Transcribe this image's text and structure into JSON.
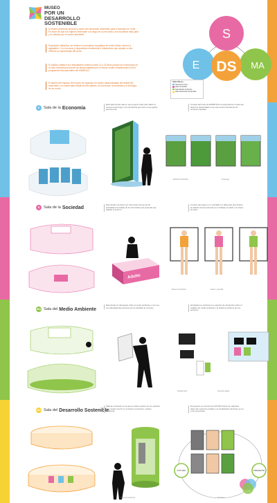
{
  "colors": {
    "blue": "#6fc1e8",
    "orange": "#f3a23a",
    "pink": "#e86aa4",
    "green": "#8fc54a",
    "yellow": "#f6d234",
    "forest": "#3d8a3a",
    "gray": "#b7b7b7"
  },
  "header": {
    "museo": "MUSEO",
    "por_un": "POR UN",
    "desarrollo": "DESARROLLO",
    "sostenible": "SOSTENIBLE",
    "intro_1": "El Museo pretende acercar la visión del desarrollo sostenible para el llamado de Chile. En favor de que los viajeros entiendan a lo largo de su recorrido, una sociedad más justa y el cuidado por el medio ambiente.",
    "intro_2": "Exposición didáctica, se centra en conceptos complejos de modo eficaz, ameno y agradable. Con recursos y dispositivos multimedia e interactivos que ayudan a una reflexión al aprendizaje del tema.",
    "intro_3": "El público objetivo son estudiantes chilenos entre 11 y 18 años porque se encuentran en el ciclo educacional donde los temas tratados por el museo están considerados en los programas educacionales del MINEDUC.",
    "intro_4": "El diseño del espacio del museo se organiza en cuatro salas basadas del desarrollo sostenible. La cuarta sala refleja los tres pilares: la economía, la sociedad y la ecología de un modo.",
    "venn": {
      "s": "S",
      "e": "E",
      "ma": "MA",
      "ds": "DS"
    },
    "legend": [
      {
        "label": "Sala Economía",
        "color": "#6fc1e8"
      },
      {
        "label": "Sala Sociedad",
        "color": "#e86aa4"
      },
      {
        "label": "Sala Medio Ambiente",
        "color": "#8fc54a"
      },
      {
        "label": "Sala Desarrollo Sostenible",
        "color": "#f6d234"
      }
    ],
    "legend_title": "Salas Museo"
  },
  "sections": [
    {
      "badge": "E",
      "prefix": "Sala de la",
      "name": "Economía",
      "color": "#6fc1e8",
      "desc_1": "Esta sala ha sido sala en que la gente visite para saber la economía del hogar y la importancia que tiene en los gastos del día a día.",
      "desc_2": "A través del fondo de ESPIRITAS correspondiente a cada que tales han desarrollado el uso del recurso forestal de los recursos naturales.",
      "caps": [
        "ESPACIO NATURAL",
        "Personaje"
      ]
    },
    {
      "badge": "S",
      "prefix": "Sala de la",
      "name": "Sociedad",
      "color": "#e86aa4",
      "desc_1": "Esta desde una visión por intermedio del uso de las actividades de trabajo de la comunidad y las personas que habitan el entorno.",
      "desc_2": "A través del espejo en un pantalla con diferentes que ilustran la relación de las personas con el trabajo, la salud y el cuerpo humano.",
      "adult": "Adulto",
      "caps": [
        "Mesa de Interactiva",
        "Espejo y pantalla"
      ]
    },
    {
      "badge": "MA",
      "prefix": "Sala del",
      "name": "Medio Ambiente",
      "color": "#8fc54a",
      "desc_1": "Esta desde un videojuego sobre el medio ambiente y como se ven afectadas las personas por la cantidad de recursos.",
      "desc_2": "El visitante se enfrenta a un ejercicio de interacción sobre el cuidado del medio ambiente y la huella de carbono de sus acciones.",
      "caps": [
        "Pantalla táctil",
        "Ambiente digital"
      ]
    },
    {
      "badge": "DS",
      "prefix": "Sala del",
      "name": "Desarrollo Sostenible",
      "color": "#f6d234",
      "desc_1": "Sala de conclusión en la que los niños pueden ver los cambios que pueden ocurrir en el entorno económico, social y ambiental.",
      "desc_2": "El proyecto es el fondo de FUTURO donde los visitantes eligen las opciones posibles y la visualización del futuro se va a ver proyectado.",
      "circle_labels": [
        "FUTURO",
        "PRESENTE"
      ],
      "caps": [
        "Columna interactiva",
        "Pantallas"
      ]
    }
  ]
}
